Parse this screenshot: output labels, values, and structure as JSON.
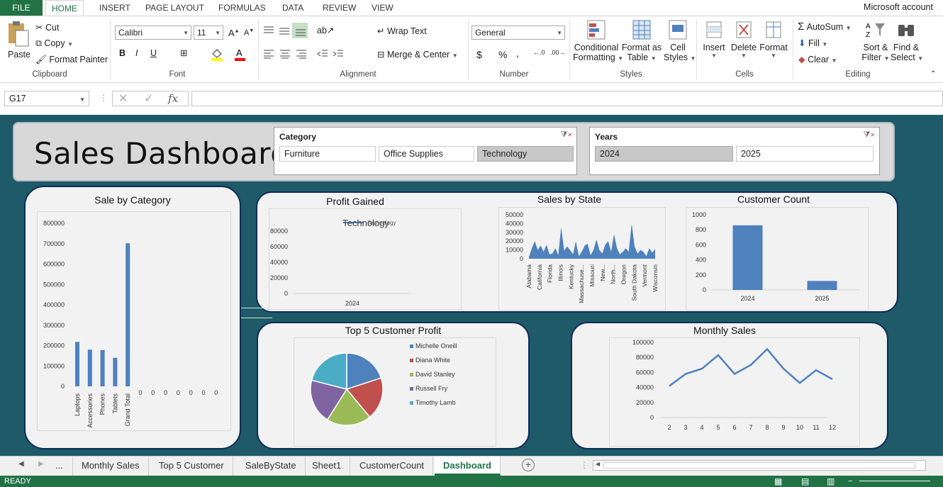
{
  "ribbon_tabs": {
    "file": "FILE",
    "home": "HOME",
    "insert": "INSERT",
    "page_layout": "PAGE LAYOUT",
    "formulas": "FORMULAS",
    "data": "DATA",
    "review": "REVIEW",
    "view": "VIEW"
  },
  "account": "Microsoft account",
  "clipboard": {
    "paste": "Paste",
    "cut": "Cut",
    "copy": "Copy",
    "format_painter": "Format Painter",
    "label": "Clipboard"
  },
  "font": {
    "name": "Calibri",
    "size": "11",
    "label": "Font"
  },
  "alignment": {
    "wrap": "Wrap Text",
    "merge": "Merge & Center",
    "label": "Alignment"
  },
  "number": {
    "format": "General",
    "label": "Number"
  },
  "styles": {
    "conditional_1": "Conditional",
    "conditional_2": "Formatting",
    "format_table_1": "Format as",
    "format_table_2": "Table",
    "cell_styles_1": "Cell",
    "cell_styles_2": "Styles",
    "label": "Styles"
  },
  "cells": {
    "insert": "Insert",
    "delete": "Delete",
    "format": "Format",
    "label": "Cells"
  },
  "editing": {
    "autosum": "AutoSum",
    "fill": "Fill",
    "clear": "Clear",
    "sort_1": "Sort &",
    "sort_2": "Filter",
    "find_1": "Find &",
    "find_2": "Select",
    "label": "Editing"
  },
  "formula_bar": {
    "name_box": "G17",
    "fx": "fx",
    "formula": ""
  },
  "dashboard": {
    "title": "Sales Dashboard",
    "category_slicer": {
      "header": "Category",
      "items": [
        "Furniture",
        "Office Supplies",
        "Technology"
      ],
      "selected": "Technology"
    },
    "years_slicer": {
      "header": "Years",
      "items": [
        "2024",
        "2025"
      ],
      "selected": "2024"
    }
  },
  "chart_data": [
    {
      "type": "bar",
      "title": "Sale by Category",
      "categories": [
        "Laptops",
        "Accessories",
        "Phones",
        "Tablets",
        "Grand Total",
        "",
        "",
        "",
        "",
        "",
        "",
        ""
      ],
      "category_labels": [
        "Laptops",
        "Accessories",
        "Phones",
        "Tablets",
        "Grand Total",
        "0",
        "0",
        "0",
        "0",
        "0",
        "0",
        "0"
      ],
      "values": [
        218000,
        180000,
        178000,
        140000,
        702000,
        0,
        0,
        0,
        0,
        0,
        0,
        0
      ],
      "y_ticks": [
        "800000",
        "700000",
        "600000",
        "500000",
        "400000",
        "300000",
        "200000",
        "100000",
        "0"
      ],
      "ylim": [
        0,
        800000
      ]
    },
    {
      "type": "line",
      "title": "Profit Gained",
      "categories": [
        "2024"
      ],
      "series": [
        {
          "name": "Technology",
          "values": [
            0
          ]
        }
      ],
      "y_ticks": [
        "80000",
        "60000",
        "40000",
        "20000",
        "0"
      ],
      "ylim": [
        0,
        80000
      ],
      "legend_text": "Technology",
      "legend_placement": "top"
    },
    {
      "type": "area",
      "title": "Sales by State",
      "categories": [
        "Alabama",
        "California",
        "Florida",
        "Illinois",
        "Kentucky",
        "Massachuse...",
        "Missouri",
        "New...",
        "North...",
        "Oregon",
        "South Dakota",
        "Vermont",
        "Wisconsin"
      ],
      "values": [
        2000,
        12000,
        20000,
        10000,
        15000,
        8000,
        16000,
        5000,
        6000,
        12000,
        4000,
        36000,
        9000,
        14000,
        10000,
        5000,
        20000,
        3000,
        8000,
        15000,
        17000,
        4000,
        10000,
        22000,
        10000,
        6000,
        16000,
        20000,
        8000,
        28000,
        12000,
        5000,
        8000,
        12000,
        8000,
        40000,
        14000,
        6000,
        10000,
        8000,
        3000,
        12000,
        7000,
        11000
      ],
      "y_ticks": [
        "50000",
        "40000",
        "30000",
        "20000",
        "10000",
        "0"
      ],
      "ylim": [
        0,
        50000
      ]
    },
    {
      "type": "bar",
      "title": "Customer Count",
      "categories": [
        "2024",
        "2025"
      ],
      "values": [
        860,
        120
      ],
      "y_ticks": [
        "1000",
        "800",
        "600",
        "400",
        "200",
        "0"
      ],
      "ylim": [
        0,
        1000
      ]
    },
    {
      "type": "pie",
      "title": "Top 5 Customer Profit",
      "labels": [
        "Michelle Oneill",
        "Diana White",
        "David Stanley",
        "Russell Fry",
        "Timothy Lamb"
      ],
      "values": [
        20,
        19,
        20,
        20,
        21
      ],
      "colors": [
        "#4f81bd",
        "#c0504d",
        "#9bbb59",
        "#8064a2",
        "#4bacc6"
      ]
    },
    {
      "type": "line",
      "title": "Monthly Sales",
      "x": [
        "2",
        "3",
        "4",
        "5",
        "6",
        "7",
        "8",
        "9",
        "10",
        "11",
        "12"
      ],
      "values": [
        42000,
        58000,
        65000,
        83000,
        58000,
        70000,
        91000,
        65000,
        46000,
        63000,
        51000
      ],
      "y_ticks": [
        "100000",
        "80000",
        "60000",
        "40000",
        "20000",
        "0"
      ],
      "ylim": [
        0,
        100000
      ]
    }
  ],
  "sheet_tabs": {
    "ellipsis": "...",
    "tabs": [
      "Monthly Sales",
      "Top 5 Customer",
      "SaleByState",
      "Sheet1",
      "CustomerCount",
      "Dashboard"
    ],
    "active": "Dashboard"
  },
  "status": "READY"
}
